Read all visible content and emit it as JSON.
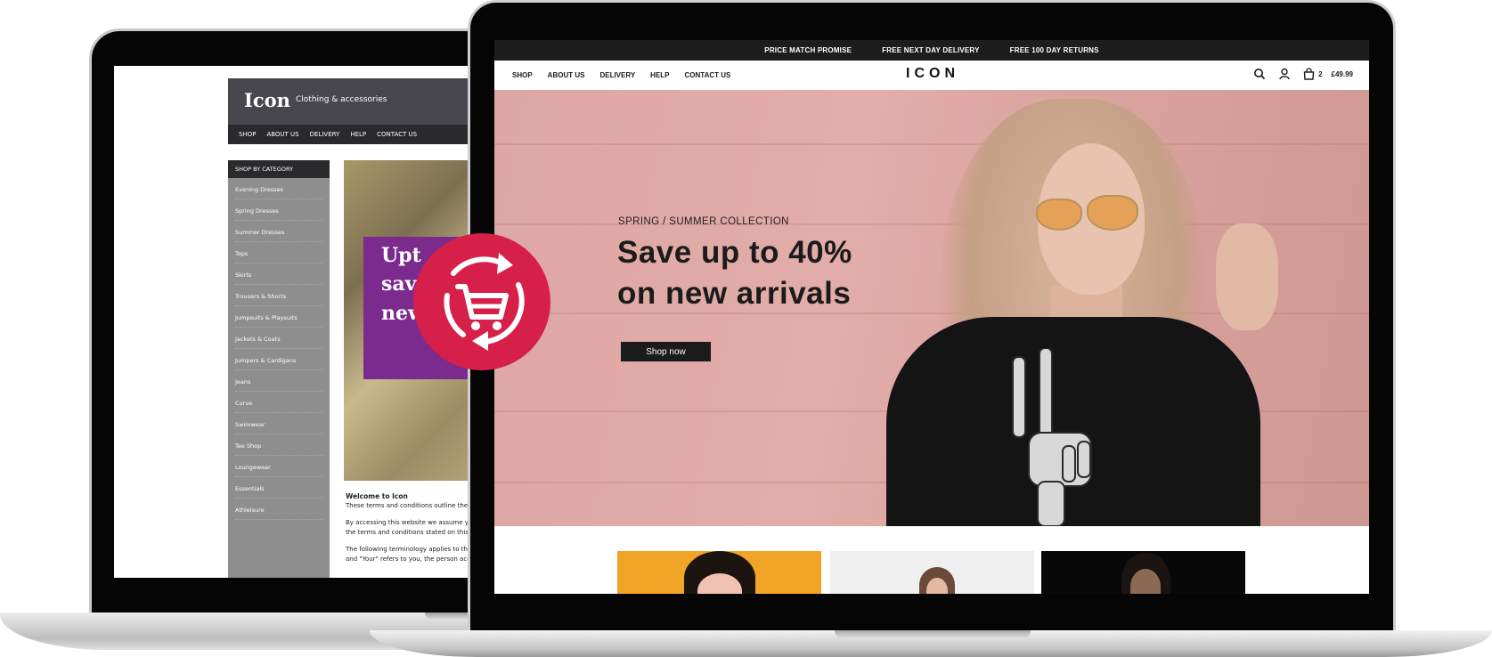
{
  "legacy_site": {
    "logo": "Icon",
    "tagline": "Clothing & accessories",
    "nav": [
      "SHOP",
      "ABOUT US",
      "DELIVERY",
      "HELP",
      "CONTACT US"
    ],
    "sidebar": {
      "title": "SHOP BY CATEGORY",
      "items": [
        "Evening Dresses",
        "Spring Dresses",
        "Summer Dresses",
        "Tops",
        "Skirts",
        "Trousers & Shorts",
        "Jumpsuits & Playsuits",
        "Jackets & Coats",
        "Jumpers & Cardigans",
        "Jeans",
        "Curve",
        "Swimwear",
        "Tee Shop",
        "Loungewear",
        "Essentials",
        "Athleisure"
      ]
    },
    "promo_lines": [
      "Upt",
      "sav",
      "new"
    ],
    "content": {
      "heading": "Welcome to Icon",
      "p1": "These terms and conditions outline the r",
      "p2a": "By accessing this website we assume yo",
      "p2b": "the terms and conditions stated on this",
      "p3a": "The following terminology applies to the",
      "p3b": "and \"Your\" refers to you, the person acc"
    },
    "colors": {
      "header": "#47474d",
      "nav": "#2a2a2c",
      "sidebar": "#8e8e8e",
      "promo": "#7a2b8d"
    }
  },
  "new_site": {
    "promo_bar": [
      "PRICE MATCH PROMISE",
      "FREE NEXT DAY DELIVERY",
      "FREE 100 DAY RETURNS"
    ],
    "nav": [
      "SHOP",
      "ABOUT US",
      "DELIVERY",
      "HELP",
      "CONTACT US"
    ],
    "brand": "ICON",
    "icons": [
      "search-icon",
      "account-icon",
      "bag-icon"
    ],
    "cart": {
      "count": "2",
      "total": "£49.99"
    },
    "hero": {
      "eyebrow": "SPRING / SUMMER COLLECTION",
      "title_line1": "Save up to 40%",
      "title_line2": "on new arrivals",
      "cta": "Shop now"
    },
    "colors": {
      "promo_bar": "#1d1d1d",
      "hero_bg": "#e2aca8",
      "cta": "#1b1b1b"
    }
  },
  "badge": {
    "icon": "cart-sync-icon",
    "color": "#d6204a"
  }
}
